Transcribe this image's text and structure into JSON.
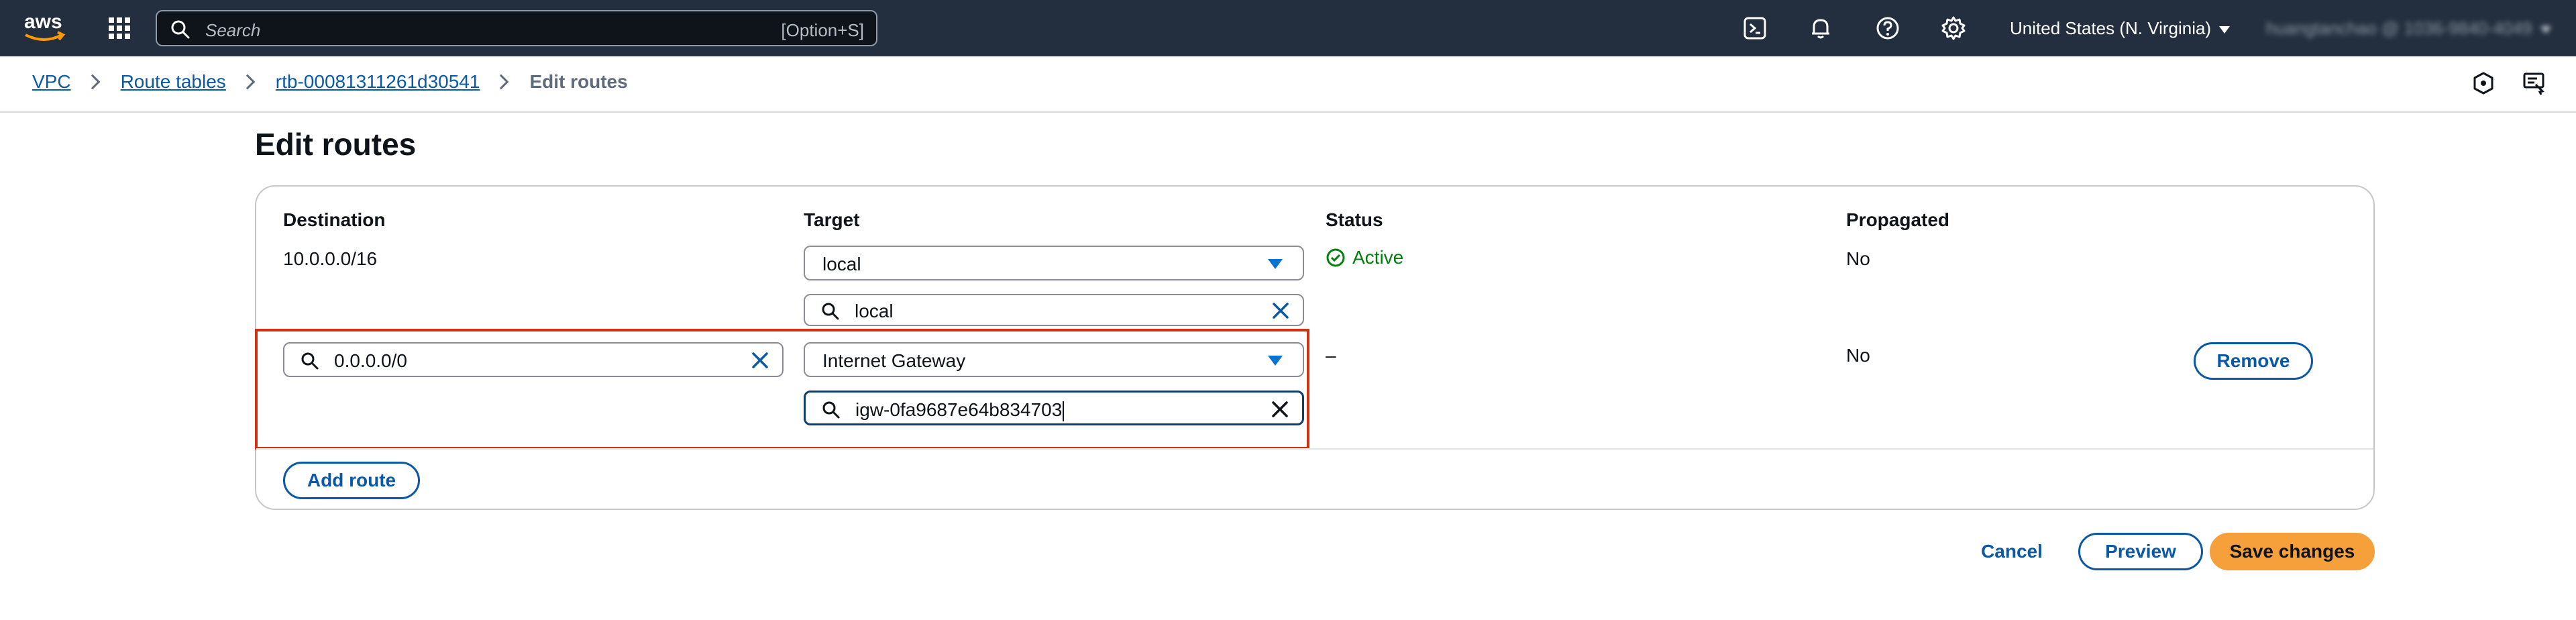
{
  "topnav": {
    "search_placeholder": "Search",
    "search_shortcut": "[Option+S]",
    "region": "United States (N. Virginia)",
    "account": "huangtanchao @ 1036-9840-4049"
  },
  "breadcrumb": {
    "items": [
      "VPC",
      "Route tables",
      "rtb-00081311261d30541"
    ],
    "current": "Edit routes"
  },
  "page": {
    "title": "Edit routes"
  },
  "table": {
    "columns": [
      "Destination",
      "Target",
      "Status",
      "Propagated"
    ],
    "rows": [
      {
        "destination": "10.0.0.0/16",
        "target": "local",
        "target_filter": "local",
        "status": "Active",
        "propagated": "No"
      },
      {
        "destination": "0.0.0.0/0",
        "target": "Internet Gateway",
        "target_filter": "igw-0fa9687e64b834703",
        "status": "–",
        "propagated": "No",
        "remove_label": "Remove"
      }
    ],
    "add_route_label": "Add route"
  },
  "footer": {
    "cancel_label": "Cancel",
    "preview_label": "Preview",
    "save_label": "Save changes"
  },
  "colors": {
    "nav_bg": "#232f3e",
    "link": "#0a58a8",
    "success": "#037f0c",
    "primary_button": "#f5a03a",
    "highlight_border": "#d13212"
  }
}
